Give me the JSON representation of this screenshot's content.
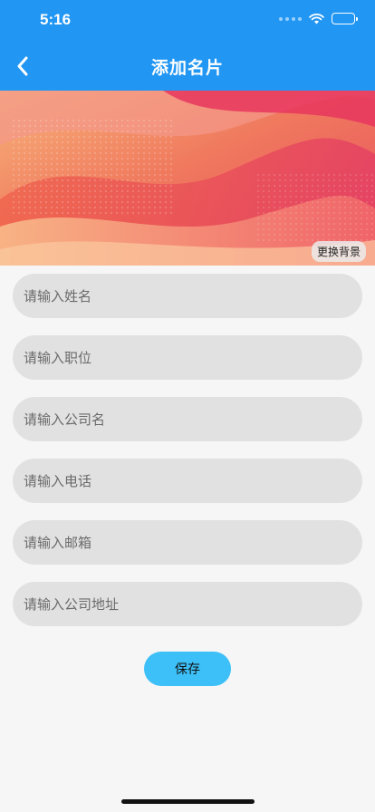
{
  "status_bar": {
    "time": "5:16",
    "wifi_icon": "wifi-icon",
    "battery_icon": "battery-icon"
  },
  "header": {
    "title": "添加名片",
    "back_icon": "chevron-left-icon",
    "color": "#2196F3"
  },
  "banner": {
    "change_background_label": "更换背景"
  },
  "form": {
    "name_placeholder": "请输入姓名",
    "position_placeholder": "请输入职位",
    "company_placeholder": "请输入公司名",
    "phone_placeholder": "请输入电话",
    "email_placeholder": "请输入邮箱",
    "address_placeholder": "请输入公司地址"
  },
  "actions": {
    "save_label": "保存",
    "save_color": "#3cc0f7"
  }
}
